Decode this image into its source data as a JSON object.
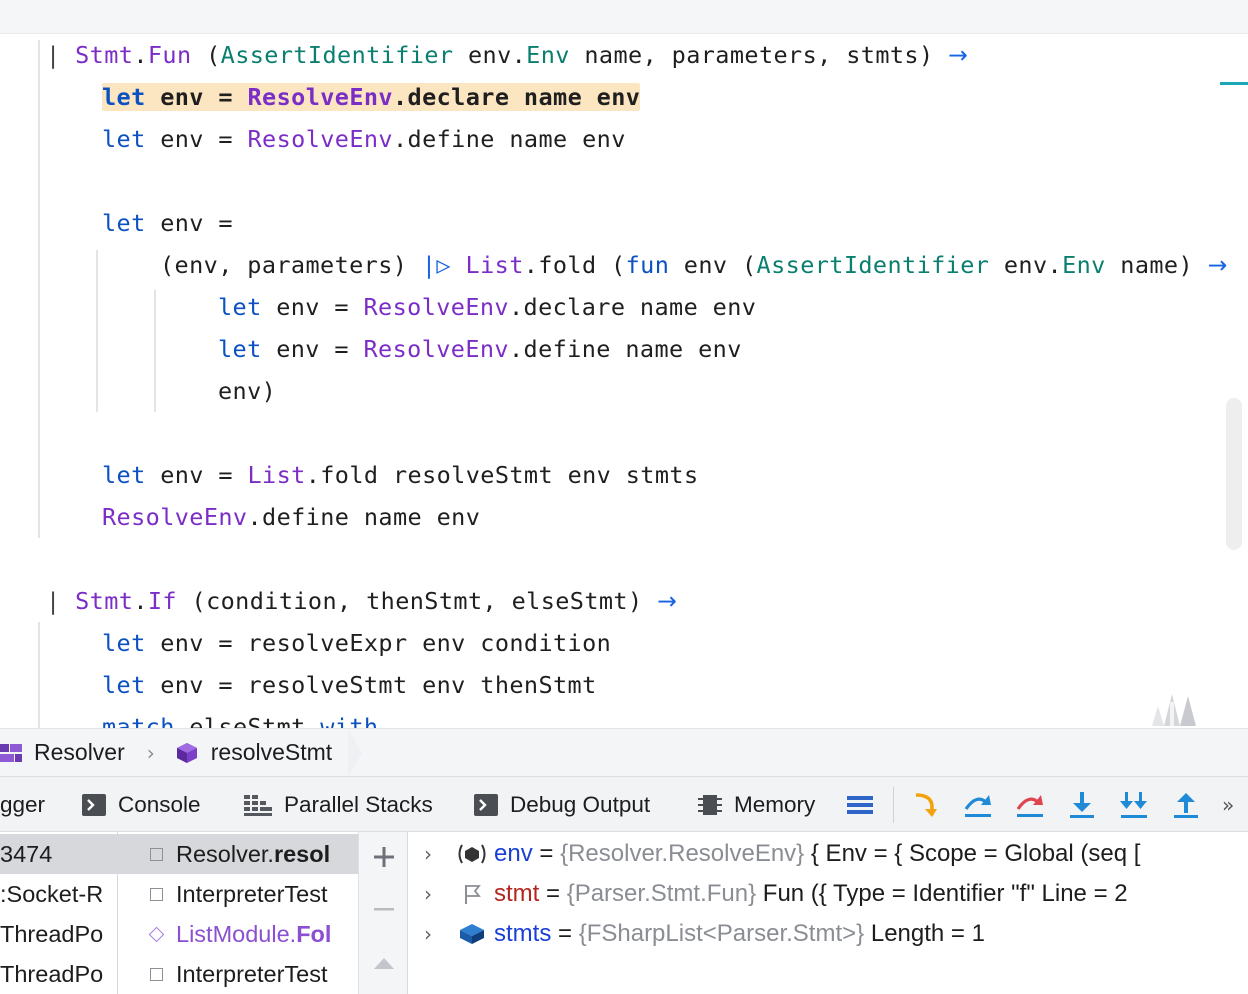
{
  "editor": {
    "lines": [
      {
        "tokens": [
          {
            "t": "| ",
            "c": "bar"
          },
          {
            "t": "Stmt",
            "c": "mod"
          },
          {
            "t": ".",
            "c": ""
          },
          {
            "t": "Fun",
            "c": "mod"
          },
          {
            "t": " (",
            "c": ""
          },
          {
            "t": "AssertIdentifier",
            "c": "typ"
          },
          {
            "t": " env.",
            "c": ""
          },
          {
            "t": "Env",
            "c": "typ"
          },
          {
            "t": " name, parameters, stmts) ",
            "c": ""
          },
          {
            "t": "→",
            "c": "arrow"
          }
        ]
      },
      {
        "tokens": [
          {
            "t": "let",
            "c": "kw"
          },
          {
            "t": " env = ",
            "c": ""
          },
          {
            "t": "ResolveEnv",
            "c": "mod"
          },
          {
            "t": ".declare name env",
            "c": ""
          }
        ]
      },
      {
        "tokens": [
          {
            "t": "let",
            "c": "kw"
          },
          {
            "t": " env = ",
            "c": ""
          },
          {
            "t": "ResolveEnv",
            "c": "mod"
          },
          {
            "t": ".define name env",
            "c": ""
          }
        ]
      },
      {
        "tokens": []
      },
      {
        "tokens": [
          {
            "t": "let",
            "c": "kw"
          },
          {
            "t": " env =",
            "c": ""
          }
        ]
      },
      {
        "tokens": [
          {
            "t": "(env, parameters) ",
            "c": ""
          },
          {
            "t": "|▷",
            "c": "pipe"
          },
          {
            "t": " ",
            "c": ""
          },
          {
            "t": "List",
            "c": "mod"
          },
          {
            "t": ".fold (",
            "c": ""
          },
          {
            "t": "fun",
            "c": "kw"
          },
          {
            "t": " env (",
            "c": ""
          },
          {
            "t": "AssertIdentifier",
            "c": "typ"
          },
          {
            "t": " env.",
            "c": ""
          },
          {
            "t": "Env",
            "c": "typ"
          },
          {
            "t": " name) ",
            "c": ""
          },
          {
            "t": "→",
            "c": "arrow"
          }
        ]
      },
      {
        "tokens": [
          {
            "t": "let",
            "c": "kw"
          },
          {
            "t": " env = ",
            "c": ""
          },
          {
            "t": "ResolveEnv",
            "c": "mod"
          },
          {
            "t": ".declare name env",
            "c": ""
          }
        ]
      },
      {
        "tokens": [
          {
            "t": "let",
            "c": "kw"
          },
          {
            "t": " env = ",
            "c": ""
          },
          {
            "t": "ResolveEnv",
            "c": "mod"
          },
          {
            "t": ".define name env",
            "c": ""
          }
        ]
      },
      {
        "tokens": [
          {
            "t": "env)",
            "c": ""
          }
        ]
      },
      {
        "tokens": []
      },
      {
        "tokens": [
          {
            "t": "let",
            "c": "kw"
          },
          {
            "t": " env = ",
            "c": ""
          },
          {
            "t": "List",
            "c": "mod"
          },
          {
            "t": ".fold resolveStmt env stmts",
            "c": ""
          }
        ]
      },
      {
        "tokens": [
          {
            "t": "ResolveEnv",
            "c": "mod"
          },
          {
            "t": ".define name env",
            "c": ""
          }
        ]
      },
      {
        "tokens": []
      },
      {
        "tokens": [
          {
            "t": "| ",
            "c": "bar"
          },
          {
            "t": "Stmt",
            "c": "mod"
          },
          {
            "t": ".",
            "c": ""
          },
          {
            "t": "If",
            "c": "mod"
          },
          {
            "t": " (condition, thenStmt, elseStmt) ",
            "c": ""
          },
          {
            "t": "→",
            "c": "arrow"
          }
        ]
      },
      {
        "tokens": [
          {
            "t": "let",
            "c": "kw"
          },
          {
            "t": " env = resolveExpr env condition",
            "c": ""
          }
        ]
      },
      {
        "tokens": [
          {
            "t": "let",
            "c": "kw"
          },
          {
            "t": " env = resolveStmt env thenStmt",
            "c": ""
          }
        ]
      },
      {
        "tokens": [
          {
            "t": "match",
            "c": "kw"
          },
          {
            "t": " elseStmt ",
            "c": ""
          },
          {
            "t": "with",
            "c": "kw"
          }
        ]
      }
    ],
    "highlighted_line": 1
  },
  "breadcrumb": {
    "items": [
      {
        "label": "Resolver",
        "icon": "module-icon"
      },
      {
        "label": "resolveStmt",
        "icon": "function-icon"
      }
    ]
  },
  "debug_toolbar": {
    "tabs": [
      {
        "label": "gger",
        "icon": ""
      },
      {
        "label": "Console",
        "icon": "console-icon"
      },
      {
        "label": "Parallel Stacks",
        "icon": "parallel-stacks-icon"
      },
      {
        "label": "Debug Output",
        "icon": "debug-output-icon"
      },
      {
        "label": "Memory",
        "icon": "memory-icon"
      }
    ],
    "buttons": [
      "frames-menu-icon",
      "show-execution-point-icon",
      "step-over-icon",
      "force-step-over-icon",
      "step-into-icon",
      "smart-step-into-icon",
      "step-out-icon"
    ],
    "more": "»"
  },
  "threads": [
    "3474",
    ":Socket-R",
    "ThreadPo",
    "ThreadPo"
  ],
  "frames": [
    {
      "prefix": "Resolver.",
      "bold": "resol",
      "lib": false
    },
    {
      "prefix": "InterpreterTest",
      "bold": "",
      "lib": false
    },
    {
      "prefix": "ListModule.",
      "bold": "Fol",
      "lib": true
    },
    {
      "prefix": "InterpreterTest",
      "bold": "",
      "lib": false
    }
  ],
  "frame_actions": [
    "+",
    "—",
    "▲"
  ],
  "variables": [
    {
      "name": "env",
      "type": "{Resolver.ResolveEnv}",
      "value": " { Env = { Scope = Global (seq [",
      "name_color": "blue",
      "icon": "closure-icon"
    },
    {
      "name": "stmt",
      "type": "{Parser.Stmt.Fun}",
      "value": " Fun ({ Type = Identifier \"f\" Line = 2",
      "name_color": "red",
      "icon": "flag-icon"
    },
    {
      "name": "stmts",
      "type": "{FSharpList<Parser.Stmt>}",
      "value": " Length = 1",
      "name_color": "blue",
      "icon": "parameter-icon"
    }
  ],
  "colors": {
    "keyword": "#0b51c1",
    "module": "#7b2ec7",
    "type": "#0a7f6f",
    "highlight": "#fbe6c1",
    "accent": "#1663e3"
  }
}
